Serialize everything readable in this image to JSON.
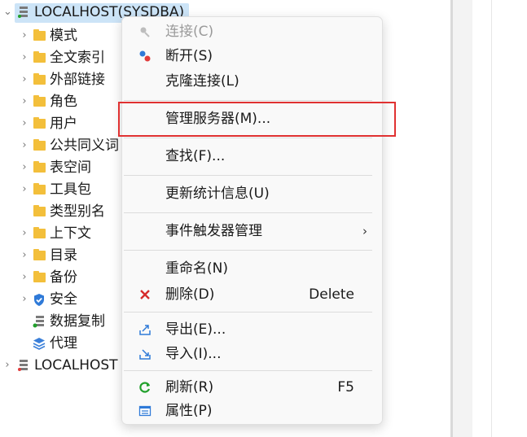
{
  "tree": {
    "root": {
      "label": "LOCALHOST(SYSDBA)",
      "expanded": true,
      "selected": true
    },
    "children": [
      {
        "label": "模式",
        "icon": "folder-icon",
        "expandable": true
      },
      {
        "label": "全文索引",
        "icon": "folder-icon",
        "expandable": true
      },
      {
        "label": "外部链接",
        "icon": "folder-icon",
        "expandable": true
      },
      {
        "label": "角色",
        "icon": "folder-icon",
        "expandable": true
      },
      {
        "label": "用户",
        "icon": "folder-icon",
        "expandable": true
      },
      {
        "label": "公共同义词",
        "icon": "folder-icon",
        "expandable": true
      },
      {
        "label": "表空间",
        "icon": "folder-icon",
        "expandable": true
      },
      {
        "label": "工具包",
        "icon": "folder-icon",
        "expandable": true
      },
      {
        "label": "类型别名",
        "icon": "folder-icon",
        "expandable": false
      },
      {
        "label": "上下文",
        "icon": "folder-icon",
        "expandable": true
      },
      {
        "label": "目录",
        "icon": "folder-icon",
        "expandable": true
      },
      {
        "label": "备份",
        "icon": "folder-icon",
        "expandable": true
      },
      {
        "label": "安全",
        "icon": "shield-icon",
        "expandable": true
      },
      {
        "label": "数据复制",
        "icon": "replication-icon",
        "expandable": false
      },
      {
        "label": "代理",
        "icon": "agent-icon",
        "expandable": false
      }
    ],
    "second_root": {
      "label": "LOCALHOST",
      "expanded": false
    }
  },
  "menu": {
    "connect": "连接(C)",
    "disconnect": "断开(S)",
    "clone_connect": "克隆连接(L)",
    "manage_server": "管理服务器(M)...",
    "find": "查找(F)...",
    "update_stats": "更新统计信息(U)",
    "event_trigger": "事件触发器管理",
    "rename": "重命名(N)",
    "delete": "删除(D)",
    "delete_key": "Delete",
    "export": "导出(E)...",
    "import": "导入(I)...",
    "refresh": "刷新(R)",
    "refresh_key": "F5",
    "properties": "属性(P)"
  },
  "colors": {
    "selection": "#cce4f7",
    "folder": "#f3bf3b",
    "highlight_box": "#e03131",
    "disabled_text": "#9a9a9a"
  }
}
